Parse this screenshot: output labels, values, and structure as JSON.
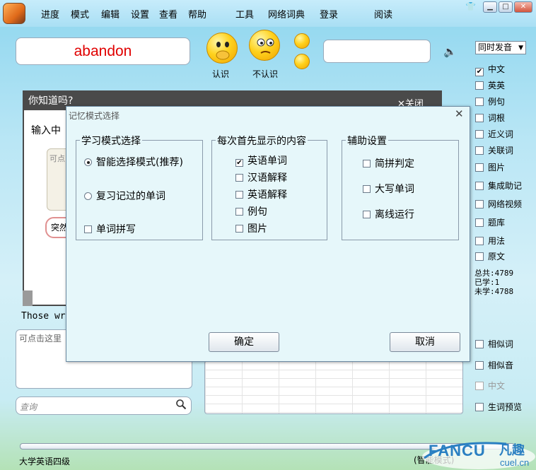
{
  "menu": [
    "进度",
    "模式",
    "编辑",
    "设置",
    "查看",
    "帮助",
    "工具",
    "网络词典",
    "登录",
    "阅读"
  ],
  "window_controls": {
    "shirt": "👕",
    "minimize": "▁",
    "maximize": "□",
    "close": "✕"
  },
  "word": "abandon",
  "buttons": {
    "know": "认识",
    "dont_know": "不认识"
  },
  "voice_select": "同时发音",
  "right_options": [
    {
      "label": "中文",
      "checked": true
    },
    {
      "label": "英英",
      "checked": false
    },
    {
      "label": "例句",
      "checked": false
    },
    {
      "label": "词根",
      "checked": false
    },
    {
      "label": "近义词",
      "checked": false
    },
    {
      "label": "关联词",
      "checked": false
    },
    {
      "label": "图片",
      "checked": false
    },
    {
      "label": "集成助记",
      "checked": false
    },
    {
      "label": "网络视频",
      "checked": false
    },
    {
      "label": "题库",
      "checked": false
    },
    {
      "label": "用法",
      "checked": false
    },
    {
      "label": "原文",
      "checked": false
    }
  ],
  "stats": {
    "total": "总共:4789",
    "learned": "已学:1",
    "unlearned": "未学:4788"
  },
  "right_options_bottom": [
    {
      "label": "相似词",
      "checked": false,
      "disabled": false
    },
    {
      "label": "相似音",
      "checked": false,
      "disabled": false
    },
    {
      "label": "中文",
      "checked": false,
      "disabled": true
    },
    {
      "label": "生词预览",
      "checked": false,
      "disabled": false
    }
  ],
  "tip_panel": {
    "title": "你知道吗?",
    "close": "✕关闭",
    "text": "输入中",
    "inner_text": "可点",
    "sudden_button": "突然"
  },
  "example_text": "Those wr",
  "note_placeholder": "可点击这里",
  "search_placeholder": "查询",
  "level": "大学英语四级",
  "mode_status": "(智能模式)",
  "watermark": {
    "brand": "FANCU",
    "cn": "凡趣",
    "url": "cuel.cn"
  },
  "dialog": {
    "title": "记忆模式选择",
    "close": "✕",
    "group_learning": {
      "title": "学习模式选择",
      "options": [
        {
          "label": "智能选择模式(推荐)",
          "kind": "radio",
          "checked": true
        },
        {
          "label": "复习记过的单词",
          "kind": "radio",
          "checked": false
        },
        {
          "label": "单词拼写",
          "kind": "checkbox",
          "checked": false
        }
      ]
    },
    "group_display": {
      "title": "每次首先显示的内容",
      "options": [
        {
          "label": "英语单词",
          "checked": true
        },
        {
          "label": "汉语解释",
          "checked": false
        },
        {
          "label": "英语解释",
          "checked": false
        },
        {
          "label": "例句",
          "checked": false
        },
        {
          "label": "图片",
          "checked": false
        }
      ]
    },
    "group_aux": {
      "title": "辅助设置",
      "options": [
        {
          "label": "简拼判定",
          "checked": false
        },
        {
          "label": "大写单词",
          "checked": false
        },
        {
          "label": "离线运行",
          "checked": false
        }
      ]
    },
    "ok": "确定",
    "cancel": "取消"
  }
}
